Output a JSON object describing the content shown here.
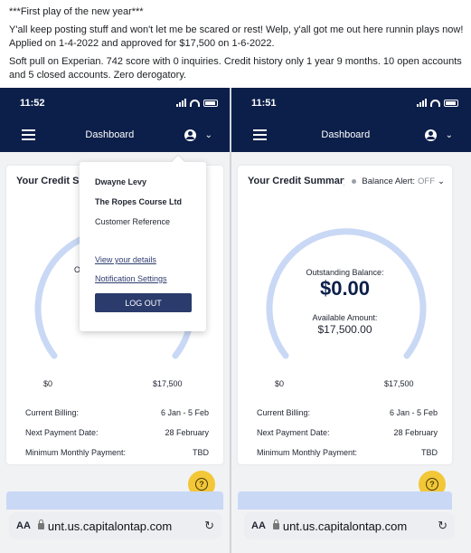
{
  "post": {
    "headline": "***First play of the new year***",
    "paragraph1": "Y'all keep posting stuff and won't let me be scared or rest!  Welp, y'all got me out here runnin plays now!  Applied on 1-4-2022 and approved for $17,500 on 1-6-2022.",
    "paragraph2": "Soft pull on Experian.  742 score with 0 inquiries.  Credit history only 1 year 9 months.  10 open accounts and 5 closed accounts.  Zero derogatory."
  },
  "left_phone": {
    "time": "11:52",
    "nav_title": "Dashboard",
    "card_title": "Your Credit Su",
    "partial_char": "O",
    "range_min": "$0",
    "range_max": "$17,500",
    "rows": [
      {
        "label": "Current Billing:",
        "value": "6 Jan - 5 Feb"
      },
      {
        "label": "Next Payment Date:",
        "value": "28 February"
      },
      {
        "label": "Minimum Monthly Payment:",
        "value": "TBD"
      }
    ],
    "url": "unt.us.capitalontap.com",
    "aa": "AA",
    "dropdown": {
      "name": "Dwayne Levy",
      "company": "The Ropes Course Ltd",
      "customer_reference": "Customer Reference",
      "view_details": "View your details",
      "notification_settings": "Notification Settings",
      "logout": "LOG OUT"
    }
  },
  "right_phone": {
    "time": "11:51",
    "nav_title": "Dashboard",
    "card_title": "Your Credit Summary",
    "balance_alert_label": "Balance Alert:",
    "balance_alert_value": "OFF",
    "outstanding_label": "Outstanding Balance:",
    "outstanding_value": "$0.00",
    "available_label": "Available Amount:",
    "available_value": "$17,500.00",
    "range_min": "$0",
    "range_max": "$17,500",
    "rows": [
      {
        "label": "Current Billing:",
        "value": "6 Jan - 5 Feb"
      },
      {
        "label": "Next Payment Date:",
        "value": "28 February"
      },
      {
        "label": "Minimum Monthly Payment:",
        "value": "TBD"
      }
    ],
    "url": "unt.us.capitalontap.com",
    "aa": "AA"
  },
  "icons": {
    "help": "?",
    "chevron": "⌄",
    "reload": "↻"
  },
  "colors": {
    "nav_bg": "#0c1f4a",
    "gauge": "#c9d8f5",
    "help_button": "#f2c738",
    "logout_button": "#2a3b6c"
  }
}
